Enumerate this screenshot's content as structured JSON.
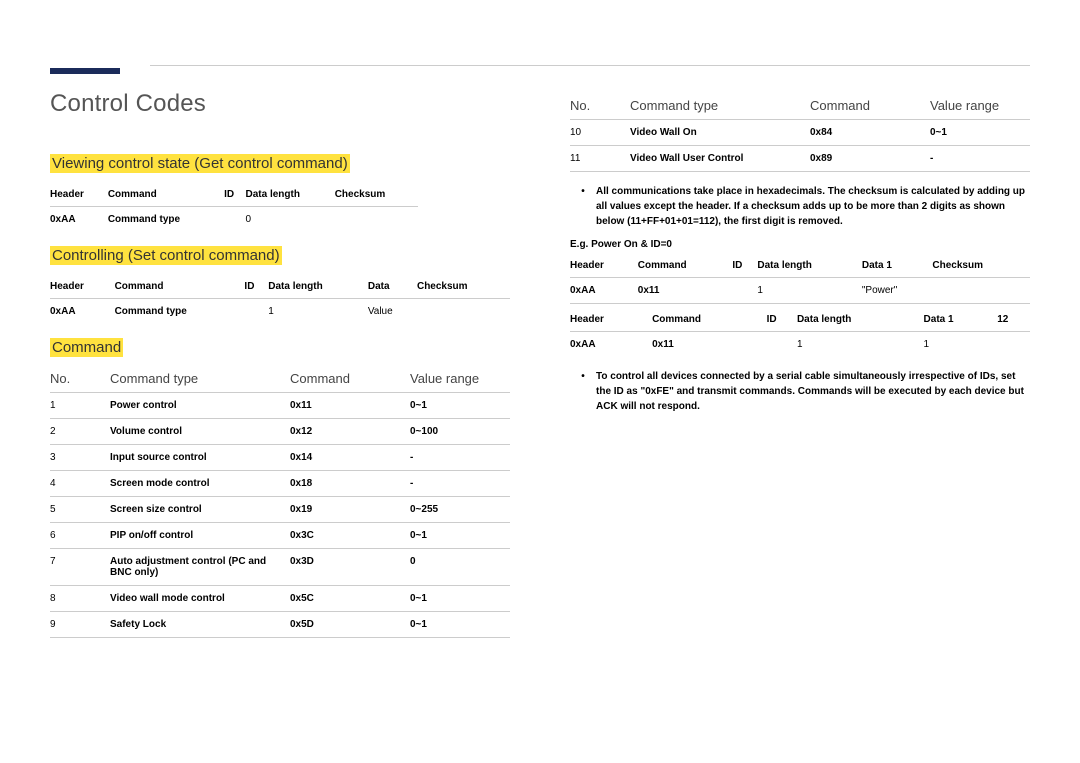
{
  "title": "Control Codes",
  "sections": {
    "viewing": {
      "heading": "Viewing control state (Get control command)",
      "table": {
        "headers": [
          "Header",
          "Command",
          "ID",
          "Data length",
          "Checksum"
        ],
        "row": [
          "0xAA",
          "Command type",
          "",
          "0",
          ""
        ]
      }
    },
    "controlling": {
      "heading": "Controlling (Set control command)",
      "table": {
        "headers": [
          "Header",
          "Command",
          "ID",
          "Data length",
          "Data",
          "Checksum"
        ],
        "row": [
          "0xAA",
          "Command type",
          "",
          "1",
          "Value",
          ""
        ]
      }
    },
    "command_heading": "Command",
    "cmd_header": {
      "no": "No.",
      "type": "Command type",
      "cmd": "Command",
      "range": "Value range"
    },
    "commands_left": [
      {
        "no": "1",
        "type": "Power control",
        "cmd": "0x11",
        "range": "0~1"
      },
      {
        "no": "2",
        "type": "Volume control",
        "cmd": "0x12",
        "range": "0~100"
      },
      {
        "no": "3",
        "type": "Input source control",
        "cmd": "0x14",
        "range": "-"
      },
      {
        "no": "4",
        "type": "Screen mode control",
        "cmd": "0x18",
        "range": "-"
      },
      {
        "no": "5",
        "type": "Screen size control",
        "cmd": "0x19",
        "range": "0~255"
      },
      {
        "no": "6",
        "type": "PIP on/off control",
        "cmd": "0x3C",
        "range": "0~1"
      },
      {
        "no": "7",
        "type": "Auto adjustment control (PC and BNC only)",
        "cmd": "0x3D",
        "range": "0"
      },
      {
        "no": "8",
        "type": "Video wall mode control",
        "cmd": "0x5C",
        "range": "0~1"
      },
      {
        "no": "9",
        "type": "Safety Lock",
        "cmd": "0x5D",
        "range": "0~1"
      }
    ],
    "commands_right": [
      {
        "no": "10",
        "type": "Video Wall On",
        "cmd": "0x84",
        "range": "0~1"
      },
      {
        "no": "11",
        "type": "Video Wall User Control",
        "cmd": "0x89",
        "range": "-"
      }
    ],
    "note1": "All communications take place in hexadecimals. The checksum is calculated by adding up all values except the header. If a checksum adds up to be more than 2 digits as shown below (11+FF+01+01=112), the first digit is removed.",
    "eg_label": "E.g. Power On & ID=0",
    "proto_a": {
      "headers": [
        "Header",
        "Command",
        "ID",
        "Data length",
        "Data 1",
        "Checksum"
      ],
      "row": [
        "0xAA",
        "0x11",
        "",
        "1",
        "\"Power\"",
        ""
      ]
    },
    "proto_b": {
      "headers": [
        "Header",
        "Command",
        "ID",
        "Data length",
        "Data 1",
        "12"
      ],
      "row": [
        "0xAA",
        "0x11",
        "",
        "1",
        "1",
        ""
      ]
    },
    "note2": "To control all devices connected by a serial cable simultaneously irrespective of IDs, set the ID as \"0xFE\" and transmit commands. Commands will be executed by each device but ACK will not respond."
  }
}
